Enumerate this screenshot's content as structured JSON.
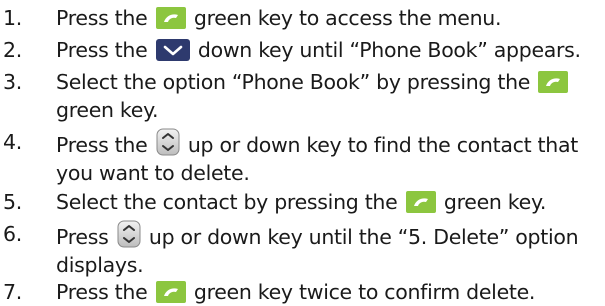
{
  "steps": [
    {
      "number": "1.",
      "parts": {
        "a": "Press the",
        "b": "green key to access the menu."
      },
      "icon": "green-key-icon"
    },
    {
      "number": "2.",
      "parts": {
        "a": "Press the",
        "b": "down key until “Phone Book” appears."
      },
      "icon": "down-key-icon"
    },
    {
      "number": "3.",
      "parts": {
        "a": "Select the option “Phone Book” by pressing the",
        "b": "green key."
      },
      "icon": "green-key-icon"
    },
    {
      "number": "4.",
      "parts": {
        "a": "Press the",
        "b": "up or down key to find the contact that",
        "c": "you want to delete."
      },
      "icon": "up-down-key-icon"
    },
    {
      "number": "5.",
      "parts": {
        "a": "Select the contact by pressing the",
        "b": "green key."
      },
      "icon": "green-key-icon"
    },
    {
      "number": "6.",
      "parts": {
        "a": "Press",
        "b": "up or down key until the “5. Delete” option",
        "c": "displays."
      },
      "icon": "up-down-key-icon"
    },
    {
      "number": "7.",
      "parts": {
        "a": "Press the",
        "b": "green key twice to confirm delete."
      },
      "icon": "green-key-icon"
    }
  ],
  "colors": {
    "green_key": "#8cc63f",
    "navy_key": "#2e3a6e",
    "text": "#1a1a1a"
  }
}
